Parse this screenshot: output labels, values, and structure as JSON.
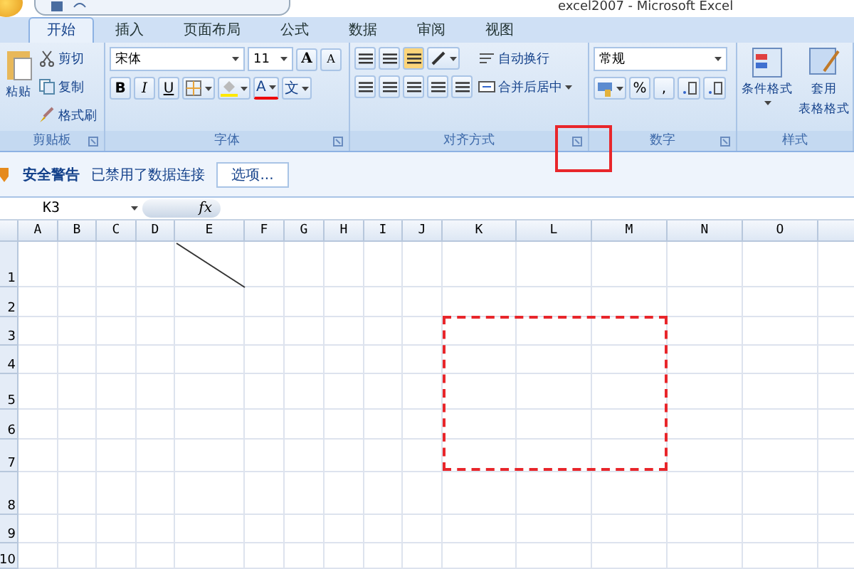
{
  "window": {
    "title": "excel2007 - Microsoft Excel"
  },
  "tabs": [
    {
      "label": "开始",
      "selected": true
    },
    {
      "label": "插入",
      "selected": false
    },
    {
      "label": "页面布局",
      "selected": false
    },
    {
      "label": "公式",
      "selected": false
    },
    {
      "label": "数据",
      "selected": false
    },
    {
      "label": "审阅",
      "selected": false
    },
    {
      "label": "视图",
      "selected": false
    }
  ],
  "ribbon": {
    "clipboard": {
      "paste": "粘贴",
      "cut": "剪切",
      "copy": "复制",
      "format_painter": "格式刷",
      "label": "剪贴板"
    },
    "font": {
      "font_name": "宋体",
      "font_size": "11",
      "grow": "A",
      "shrink": "A",
      "bold": "B",
      "italic": "I",
      "underline": "U",
      "font_color": "A",
      "phonetic": "文",
      "label": "字体"
    },
    "alignment": {
      "wrap_text": "自动换行",
      "merge_center": "合并后居中",
      "label": "对齐方式"
    },
    "number": {
      "format": "常规",
      "percent": "%",
      "comma": ",",
      "label": "数字"
    },
    "styles": {
      "conditional": "条件格式",
      "table_format": [
        "套用",
        "表格格式"
      ],
      "label": "样式"
    }
  },
  "security_bar": {
    "title": "安全警告",
    "message": "已禁用了数据连接",
    "options": "选项..."
  },
  "formula_bar": {
    "name_box": "K3",
    "fx": "fx"
  },
  "columns": [
    "A",
    "B",
    "C",
    "D",
    "E",
    "F",
    "G",
    "H",
    "I",
    "J",
    "K",
    "L",
    "M",
    "N",
    "O"
  ],
  "rows": [
    "1",
    "2",
    "3",
    "4",
    "5",
    "6",
    "7",
    "8",
    "9",
    "10"
  ]
}
